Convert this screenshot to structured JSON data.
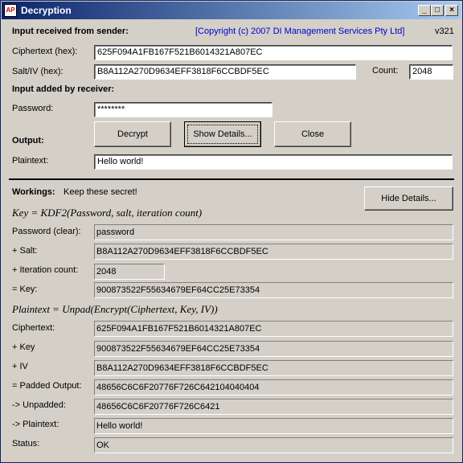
{
  "window": {
    "title": "Decryption",
    "icon_text": "AP"
  },
  "header": {
    "section_title": "Input received from sender:",
    "copyright": "[Copyright (c) 2007 DI Management Services Pty Ltd]",
    "version": "v321"
  },
  "input": {
    "ciphertext_label": "Ciphertext (hex):",
    "ciphertext": "625F094A1FB167F521B6014321A807EC",
    "salt_label": "Salt/IV (hex):",
    "salt": "B8A112A270D9634EFF3818F6CCBDF5EC",
    "count_label": "Count:",
    "count": "2048"
  },
  "receiver": {
    "section_title": "Input added by receiver:",
    "password_label": "Password:",
    "password_masked": "********"
  },
  "output": {
    "label": "Output:",
    "decrypt_button": "Decrypt",
    "show_details_button": "Show Details...",
    "close_button": "Close",
    "plaintext_label": "Plaintext:",
    "plaintext": "Hello world!"
  },
  "workings": {
    "label": "Workings:",
    "note": "Keep these secret!",
    "hide_details_button": "Hide Details...",
    "kdf_formula": "Key = KDF2(Password, salt, iteration count)",
    "password_clear_label": "Password (clear):",
    "password_clear": "password",
    "salt_label": "+ Salt:",
    "salt": "B8A112A270D9634EFF3818F6CCBDF5EC",
    "iteration_label": "+ Iteration count:",
    "iteration": "2048",
    "key_label": "= Key:",
    "key": "900873522F55634679EF64CC25E73354",
    "decrypt_formula": "Plaintext = Unpad(Encrypt(Ciphertext, Key, IV))",
    "ciphertext_label": "Ciphertext:",
    "ciphertext": "625F094A1FB167F521B6014321A807EC",
    "plus_key_label": "+ Key",
    "plus_key": "900873522F55634679EF64CC25E73354",
    "iv_label": "+ IV",
    "iv": "B8A112A270D9634EFF3818F6CCBDF5EC",
    "padded_label": "= Padded Output:",
    "padded": "48656C6C6F20776F726C642104040404",
    "unpadded_label": "-> Unpadded:",
    "unpadded": "48656C6C6F20776F726C6421",
    "plaintext_label": "-> Plaintext:",
    "plaintext": "Hello world!",
    "status_label": "Status:",
    "status": "OK"
  }
}
